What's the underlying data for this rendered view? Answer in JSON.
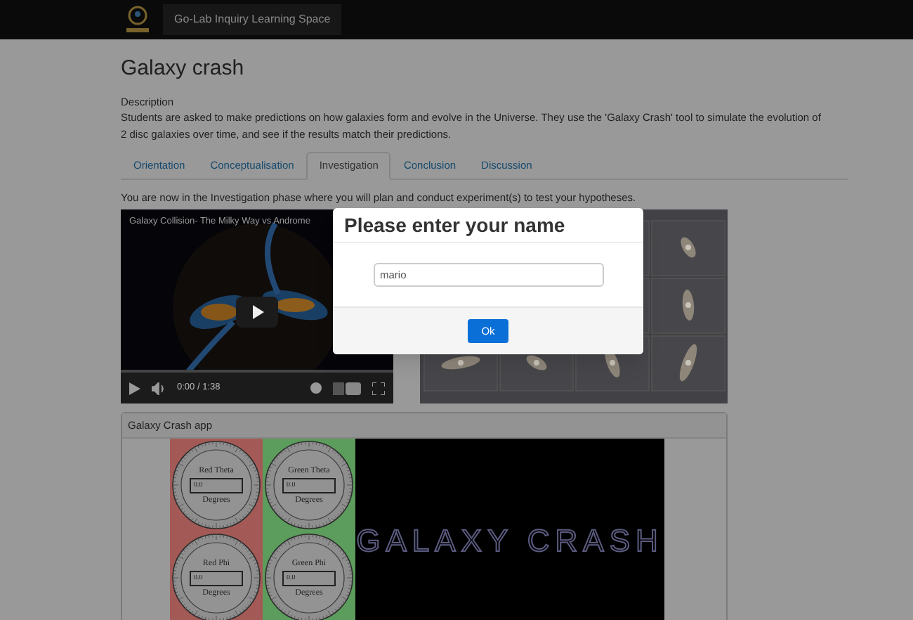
{
  "header": {
    "title": "Go-Lab Inquiry Learning Space"
  },
  "page": {
    "title": "Galaxy crash",
    "description_label": "Description",
    "description": "Students are asked to make predictions on how galaxies form and evolve in the Universe. They use the 'Galaxy Crash' tool to simulate the evolution of 2 disc galaxies over time, and see if the results match their predictions."
  },
  "tabs": [
    {
      "label": "Orientation",
      "selected": false
    },
    {
      "label": "Conceptualisation",
      "selected": false
    },
    {
      "label": "Investigation",
      "selected": true
    },
    {
      "label": "Conclusion",
      "selected": false
    },
    {
      "label": "Discussion",
      "selected": false
    }
  ],
  "phase_text": "You are now in the Investigation phase where you will plan and conduct experiment(s) to test your hypotheses.",
  "video": {
    "title": "Galaxy Collision- The Milky Way vs Androme",
    "time": "0:00 / 1:38"
  },
  "app": {
    "title": "Galaxy Crash app",
    "logo_text": "GALAXY CRASH",
    "columns": [
      {
        "color": "#a35a56",
        "dials": [
          {
            "label": "Red Theta",
            "value": "0.0",
            "unit": "Degrees"
          },
          {
            "label": "Red Phi",
            "value": "0.0",
            "unit": "Degrees"
          }
        ]
      },
      {
        "color": "#5c9c5c",
        "dials": [
          {
            "label": "Green Theta",
            "value": "0.0",
            "unit": "Degrees"
          },
          {
            "label": "Green Phi",
            "value": "0.0",
            "unit": "Degrees"
          }
        ]
      }
    ]
  },
  "dialog": {
    "title": "Please enter your name",
    "value": "mario",
    "button": "Ok"
  }
}
